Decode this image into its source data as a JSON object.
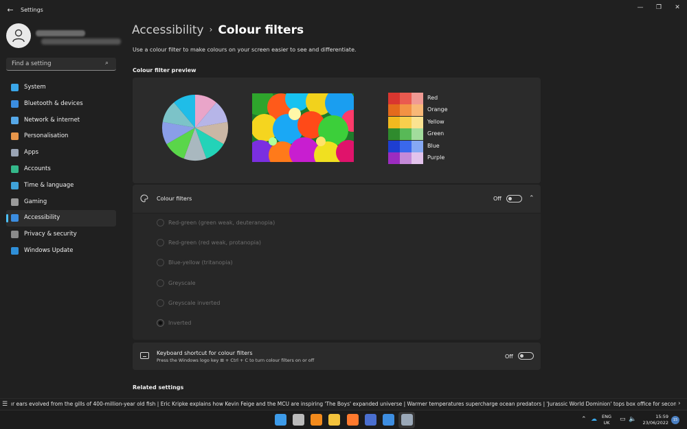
{
  "window": {
    "title": "Settings",
    "back_icon": "back-arrow-icon",
    "controls": [
      "minimize-icon",
      "maximize-icon",
      "close-icon"
    ]
  },
  "sidebar": {
    "search_placeholder": "Find a setting",
    "items": [
      {
        "label": "System",
        "icon": "system-icon",
        "color": "#3aa6e8"
      },
      {
        "label": "Bluetooth & devices",
        "icon": "bluetooth-icon",
        "color": "#3b8de0"
      },
      {
        "label": "Network & internet",
        "icon": "wifi-icon",
        "color": "#56a8e8"
      },
      {
        "label": "Personalisation",
        "icon": "brush-icon",
        "color": "#e8964a"
      },
      {
        "label": "Apps",
        "icon": "apps-icon",
        "color": "#9aa4b4"
      },
      {
        "label": "Accounts",
        "icon": "accounts-icon",
        "color": "#34b88a"
      },
      {
        "label": "Time & language",
        "icon": "globe-icon",
        "color": "#3fa2d8"
      },
      {
        "label": "Gaming",
        "icon": "gamepad-icon",
        "color": "#9a9a9a"
      },
      {
        "label": "Accessibility",
        "icon": "accessibility-icon",
        "color": "#3b8de0",
        "active": true
      },
      {
        "label": "Privacy & security",
        "icon": "shield-icon",
        "color": "#8a8a8a"
      },
      {
        "label": "Windows Update",
        "icon": "update-icon",
        "color": "#2f8fd8"
      }
    ]
  },
  "main": {
    "breadcrumb_parent": "Accessibility",
    "breadcrumb_separator": "›",
    "page_title": "Colour filters",
    "description": "Use a colour filter to make colours on your screen easier to see and differentiate.",
    "preview_title": "Colour filter preview",
    "swatches": [
      {
        "label": "Red",
        "colors": [
          "#d9362f",
          "#ea5a4f",
          "#f09a94"
        ]
      },
      {
        "label": "Orange",
        "colors": [
          "#e46a1c",
          "#f39244",
          "#f8b877"
        ]
      },
      {
        "label": "Yellow",
        "colors": [
          "#f1b91f",
          "#f8cf4d",
          "#fbe391"
        ]
      },
      {
        "label": "Green",
        "colors": [
          "#2f8b2d",
          "#58b957",
          "#a2dc9c"
        ]
      },
      {
        "label": "Blue",
        "colors": [
          "#1e3ed1",
          "#3a68ec",
          "#86a8f3"
        ]
      },
      {
        "label": "Purple",
        "colors": [
          "#9c2cc0",
          "#c58ad8",
          "#e3c3ec"
        ]
      }
    ],
    "colour_filters": {
      "label": "Colour filters",
      "toggle_state": "Off",
      "options": [
        {
          "label": "Red-green (green weak, deuteranopia)",
          "selected": false
        },
        {
          "label": "Red-green (red weak, protanopia)",
          "selected": false
        },
        {
          "label": "Blue-yellow (tritanopia)",
          "selected": false
        },
        {
          "label": "Greyscale",
          "selected": false
        },
        {
          "label": "Greyscale inverted",
          "selected": false
        },
        {
          "label": "Inverted",
          "selected": true
        }
      ]
    },
    "shortcut": {
      "title": "Keyboard shortcut for colour filters",
      "subtitle": "Press the Windows logo key ⊞ + Ctrl + C to turn colour filters on or off",
      "toggle_state": "Off"
    },
    "related_title": "Related settings"
  },
  "ticker": {
    "text": "ır ears evolved from the gills of 400-million-year old fish   |   Eric Kripke explains how Kevin Feige and the MCU are inspiring 'The Boys' expanded universe   |   Warmer temperatures supercharge ocean predators   |   'Jurassic World Dominion' tops box office for second straight week"
  },
  "taskbar": {
    "icons": [
      {
        "name": "start-icon",
        "color": "#3d9be9"
      },
      {
        "name": "task-view-icon",
        "color": "#bbbbbb"
      },
      {
        "name": "rss-icon",
        "color": "#f28a1c"
      },
      {
        "name": "file-explorer-icon",
        "color": "#f3c23c"
      },
      {
        "name": "firefox-icon",
        "color": "#ff7a2e"
      },
      {
        "name": "app-icon",
        "color": "#4a6fd0"
      },
      {
        "name": "todo-icon",
        "color": "#3d8de0"
      },
      {
        "name": "settings-icon",
        "color": "#9aa8b8"
      }
    ],
    "lang_line1": "ENG",
    "lang_line2": "UK",
    "time": "15:59",
    "date": "23/06/2022",
    "notification_count": "15"
  }
}
